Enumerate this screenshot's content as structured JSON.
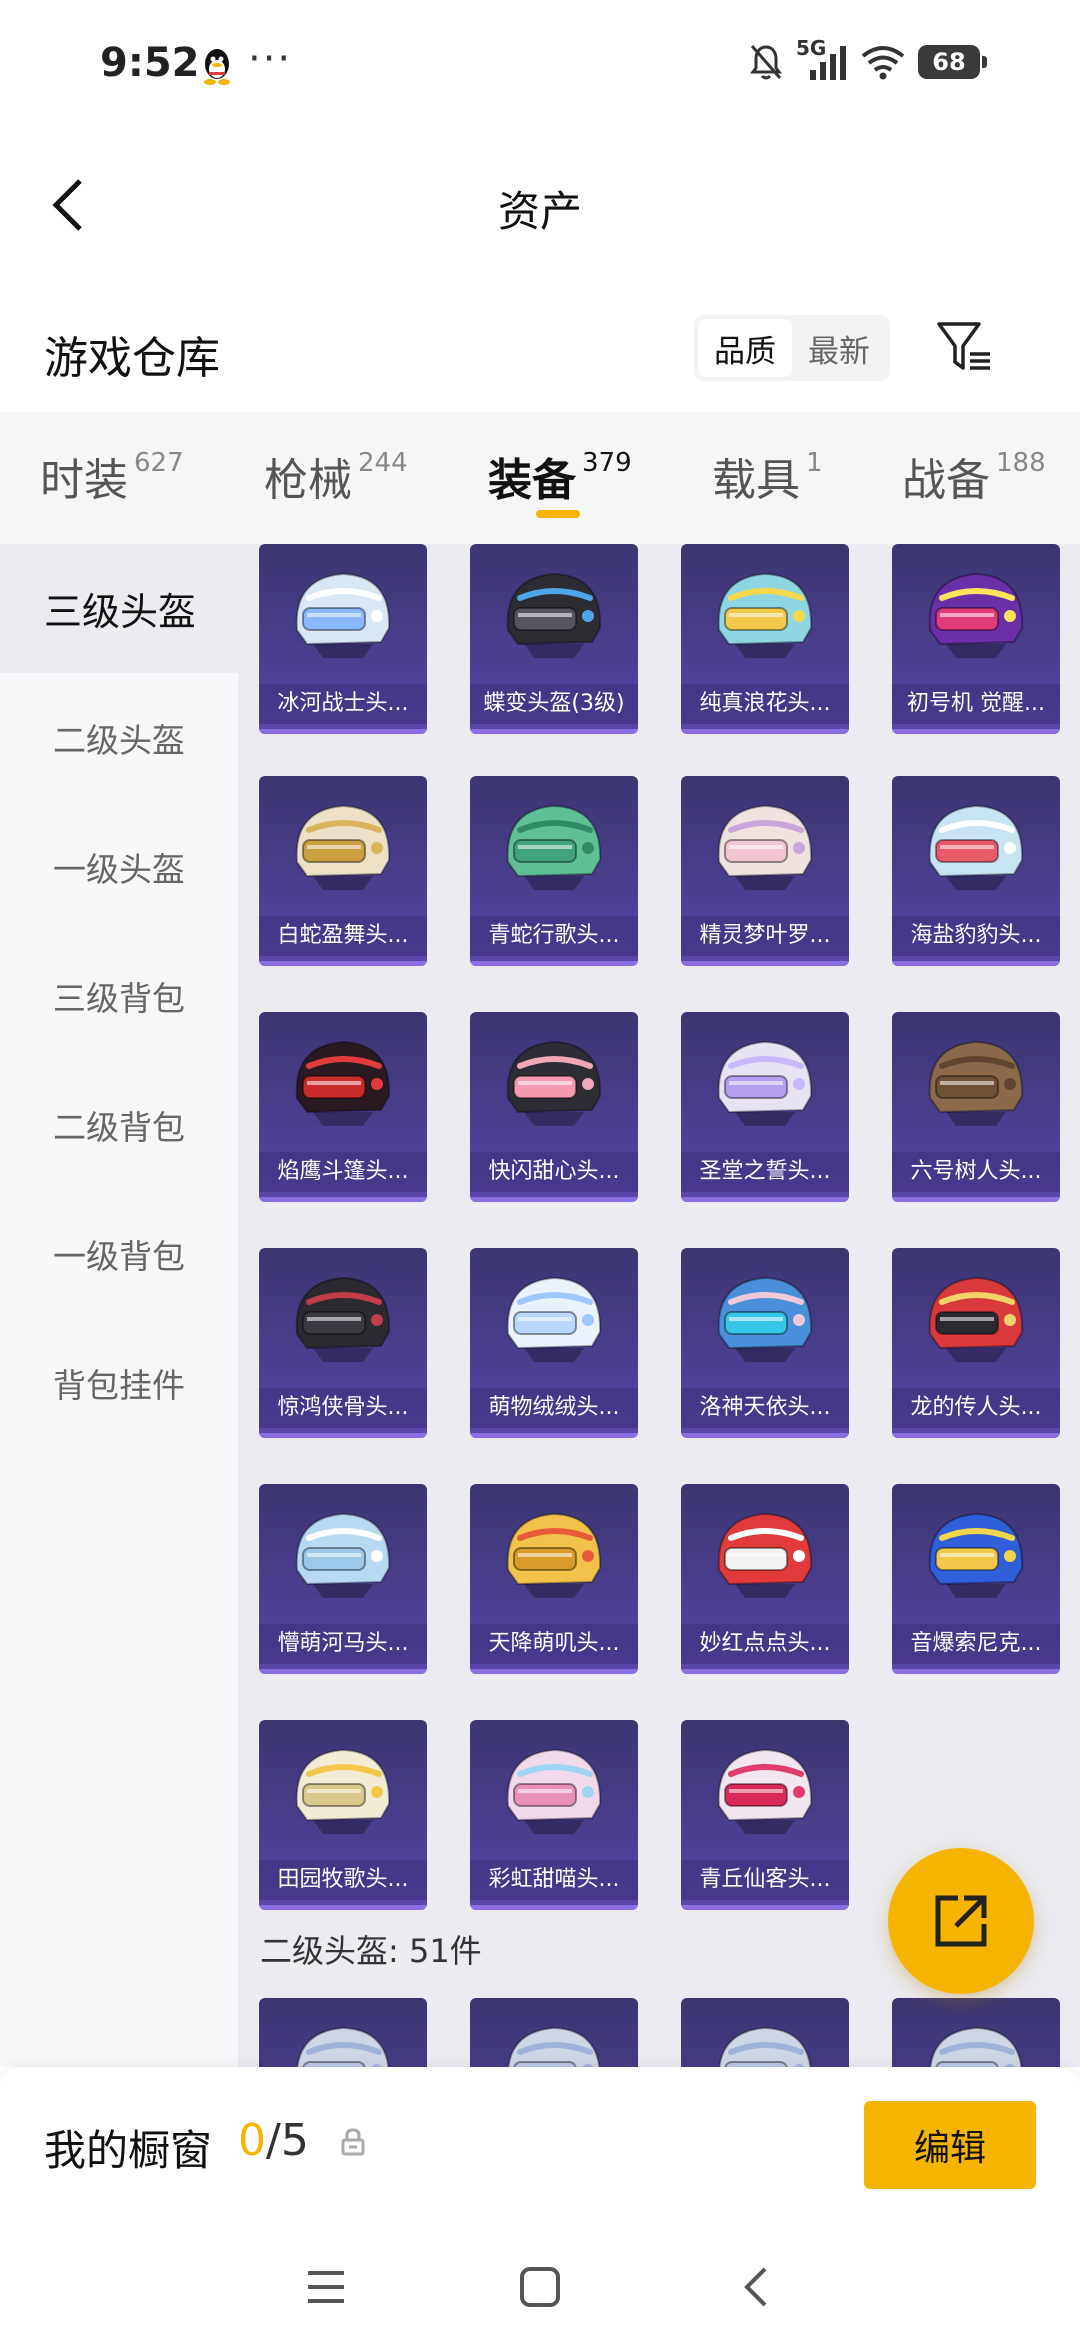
{
  "status": {
    "time": "9:52",
    "dots": "···",
    "network": "5G",
    "battery": "68"
  },
  "header": {
    "title": "资产"
  },
  "warehouse": {
    "title": "游戏仓库",
    "sort_quality": "品质",
    "sort_newest": "最新"
  },
  "tabs": [
    {
      "label": "时装",
      "count": "627"
    },
    {
      "label": "枪械",
      "count": "244"
    },
    {
      "label": "装备",
      "count": "379"
    },
    {
      "label": "载具",
      "count": "1"
    },
    {
      "label": "战备",
      "count": "188"
    }
  ],
  "sidebar": {
    "items": [
      "三级头盔",
      "二级头盔",
      "一级头盔",
      "三级背包",
      "二级背包",
      "一级背包",
      "背包挂件"
    ]
  },
  "items": [
    {
      "name": "冰河战士头...",
      "color": "#d9e7f5",
      "accent": "#ffffff",
      "visor": "#8ab8ff"
    },
    {
      "name": "蝶变头盔(3级)",
      "color": "#2c2c33",
      "accent": "#4fa6e8",
      "visor": "#555560"
    },
    {
      "name": "纯真浪花头...",
      "color": "#8fd6e3",
      "accent": "#f7d84a",
      "visor": "#f2c84b"
    },
    {
      "name": "初号机 觉醒...",
      "color": "#6b2fa8",
      "accent": "#ffe35c",
      "visor": "#e23b7a"
    },
    {
      "name": "白蛇盈舞头...",
      "color": "#ece0c6",
      "accent": "#d9b45c",
      "visor": "#caa040"
    },
    {
      "name": "青蛇行歌头...",
      "color": "#5fbf97",
      "accent": "#2f8a66",
      "visor": "#3fa37d"
    },
    {
      "name": "精灵梦叶罗...",
      "color": "#efe3df",
      "accent": "#c8a6d9",
      "visor": "#f2c5d3"
    },
    {
      "name": "海盐豹豹头...",
      "color": "#c8e4f2",
      "accent": "#ffffff",
      "visor": "#e85a6a"
    },
    {
      "name": "焰鹰斗篷头...",
      "color": "#2a1a22",
      "accent": "#e23b3b",
      "visor": "#c92a2a"
    },
    {
      "name": "快闪甜心头...",
      "color": "#2d2d35",
      "accent": "#f2a7b8",
      "visor": "#f59ab0"
    },
    {
      "name": "圣堂之誓头...",
      "color": "#e7e3f2",
      "accent": "#c7b8ff",
      "visor": "#b49ff0"
    },
    {
      "name": "六号树人头...",
      "color": "#8a6a4a",
      "accent": "#5e4631",
      "visor": "#6e5238"
    },
    {
      "name": "惊鸿侠骨头...",
      "color": "#2a2a30",
      "accent": "#c23c4a",
      "visor": "#3a3a42"
    },
    {
      "name": "萌物绒绒头...",
      "color": "#eaf2fb",
      "accent": "#9fc7ff",
      "visor": "#b9d7ff"
    },
    {
      "name": "洛神天依头...",
      "color": "#4a8fd9",
      "accent": "#f0c8d8",
      "visor": "#38c6e8"
    },
    {
      "name": "龙的传人头...",
      "color": "#d9393a",
      "accent": "#f2d36b",
      "visor": "#2a2a30"
    },
    {
      "name": "懵萌河马头...",
      "color": "#b7d9f2",
      "accent": "#ffffff",
      "visor": "#9ec8ea"
    },
    {
      "name": "天降萌叽头...",
      "color": "#f2c24a",
      "accent": "#e85a3a",
      "visor": "#d99b2a"
    },
    {
      "name": "妙红点点头...",
      "color": "#e03a3a",
      "accent": "#ffffff",
      "visor": "#f2f2f2"
    },
    {
      "name": "音爆索尼克...",
      "color": "#2f5fd9",
      "accent": "#f2d34a",
      "visor": "#f2c84b"
    },
    {
      "name": "田园牧歌头...",
      "color": "#f2ecd6",
      "accent": "#f2c84b",
      "visor": "#d9c98a"
    },
    {
      "name": "彩虹甜喵头...",
      "color": "#f0d9ea",
      "accent": "#9fd4f2",
      "visor": "#e890b8"
    },
    {
      "name": "青丘仙客头...",
      "color": "#f2e6f0",
      "accent": "#e23b6e",
      "visor": "#d92a5a"
    }
  ],
  "section": {
    "label": "二级头盔: 51件"
  },
  "bottom": {
    "window_label": "我的橱窗",
    "window_current": "0",
    "window_total": "/5",
    "edit_label": "编辑"
  }
}
